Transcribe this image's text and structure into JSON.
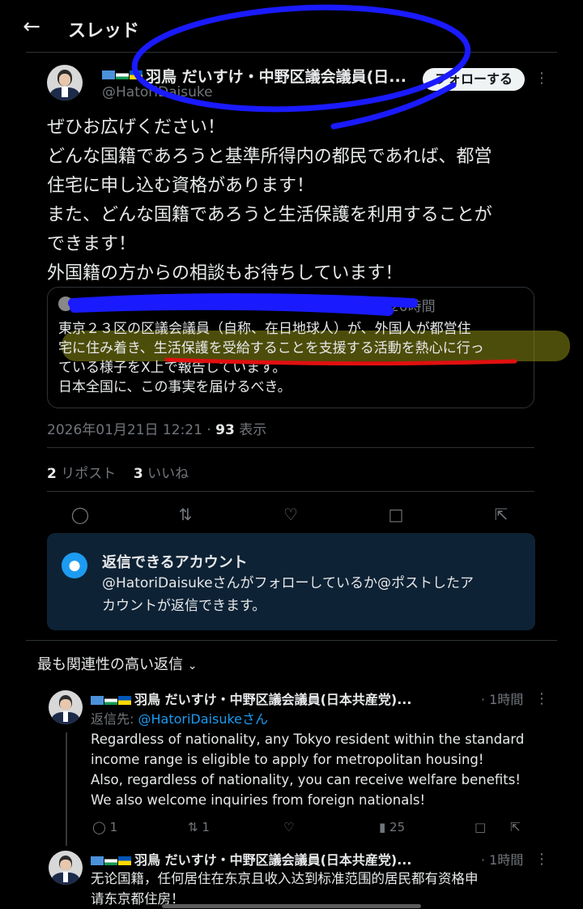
{
  "header": {
    "title": "スレッド"
  },
  "post": {
    "display_name": "羽鳥 だいすけ・中野区議会議員(日...",
    "handle": "@HatoriDaisuke",
    "follow_label": "フォローする",
    "body_lines": [
      "ぜひお広げください！",
      "どんな国籍であろうと基準所得内の都民であれば、都営",
      "住宅に申し込む資格があります！",
      "また、どんな国籍であろうと生活保護を利用することが",
      "できます！",
      "外国籍の方からの相談もお待ちしています！"
    ],
    "quote": {
      "time": "20時間",
      "lines": [
        "東京２３区の区議会議員（自称、在日地球人）が、外国人が都営住",
        "宅に住み着き、生活保護を受給することを支援する活動を熱心に行っ",
        "ている様子をX上で報告しています。",
        "日本全国に、この事実を届けるべき。"
      ]
    },
    "timestamp": "2026年01月21日 12:21",
    "views_count": "93",
    "views_label": "表示",
    "reposts_count": "2",
    "reposts_label": "リポスト",
    "likes_count": "3",
    "likes_label": "いいね"
  },
  "reply_restriction": {
    "title": "返信できるアカウント",
    "text_line1": "@HatoriDaisukeさんがフォローしているか@ポストしたア",
    "text_line2": "カウントが返信できます。"
  },
  "sort": {
    "label": "最も関連性の高い返信"
  },
  "replies": [
    {
      "display_name": "羽鳥 だいすけ・中野区議会議員(日本共産党)... ",
      "time": "· 1時間",
      "reply_to_prefix": "返信先: ",
      "reply_to_handle": "@HatoriDaisukeさん",
      "lines": [
        "Regardless of nationality, any Tokyo resident within the standard",
        "income range is eligible to apply for metropolitan housing!",
        "Also, regardless of nationality, you can receive welfare benefits!",
        "We also welcome inquiries from foreign nationals!"
      ],
      "reply_count": "1",
      "repost_count": "1",
      "views": "25"
    },
    {
      "display_name": "羽鳥 だいすけ・中野区議会議員(日本共産党)... ",
      "time": "· 1時間",
      "lines": [
        "无论国籍，任何居住在东京且收入达到标准范围的居民都有资格申",
        "请东京都住房！"
      ]
    }
  ],
  "colors": {
    "accent": "#1d9bf0",
    "background": "#000000",
    "muted": "#71767b",
    "annotation_blue": "#1a1aff",
    "annotation_red": "#e01010",
    "highlight": "#7a7a14"
  }
}
